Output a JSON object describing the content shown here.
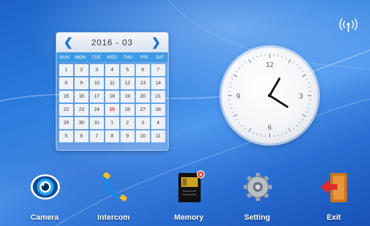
{
  "status": {
    "signal_icon": "wireless-signal-icon"
  },
  "calendar": {
    "title": "2016 - 03",
    "prev_icon": "chevron-left-icon",
    "next_icon": "chevron-right-icon",
    "prev_glyph": "❮",
    "next_glyph": "❯",
    "weekdays": [
      "SUN",
      "MON",
      "TUE",
      "WED",
      "THU",
      "FRI",
      "SAT"
    ],
    "cells": [
      "1",
      "2",
      "3",
      "4",
      "5",
      "6",
      "7",
      "8",
      "9",
      "10",
      "11",
      "12",
      "13",
      "14",
      "15",
      "16",
      "17",
      "18",
      "19",
      "20",
      "21",
      "22",
      "23",
      "24",
      "25",
      "26",
      "27",
      "28",
      "29",
      "30",
      "31",
      "1",
      "2",
      "3",
      "4",
      "5",
      "6",
      "7",
      "8",
      "9",
      "10",
      "11"
    ],
    "highlight": "25",
    "highlight_color": "#e53a2a"
  },
  "clock": {
    "numerals": [
      "12",
      "3",
      "6",
      "9"
    ],
    "time": {
      "hour": 4,
      "minute": 5
    }
  },
  "dock": {
    "items": [
      {
        "label": "Camera",
        "icon": "camera-eye-icon"
      },
      {
        "label": "Intercom",
        "icon": "phone-handset-icon"
      },
      {
        "label": "Memory",
        "icon": "memory-card-icon"
      },
      {
        "label": "Setting",
        "icon": "gear-icon"
      },
      {
        "label": "Exit",
        "icon": "exit-door-icon"
      }
    ]
  },
  "colors": {
    "background": "#2d7fe0",
    "calendar_header_bar": "#3f9be6",
    "accent": "#1a6fd0"
  }
}
